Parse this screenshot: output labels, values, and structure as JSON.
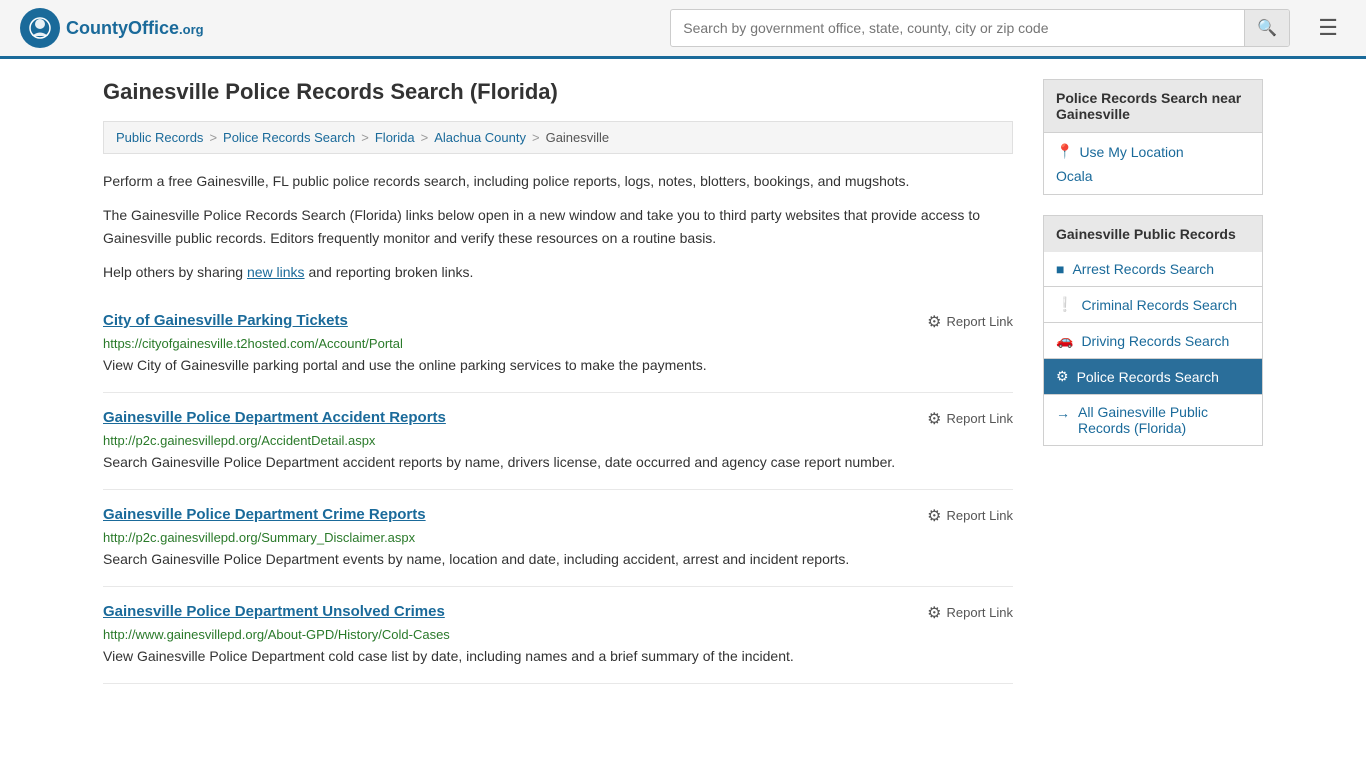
{
  "header": {
    "logo_text": "CountyOffice",
    "logo_org": ".org",
    "search_placeholder": "Search by government office, state, county, city or zip code",
    "search_value": ""
  },
  "page": {
    "title": "Gainesville Police Records Search (Florida)"
  },
  "breadcrumb": {
    "items": [
      {
        "label": "Public Records",
        "url": "#"
      },
      {
        "label": "Police Records Search",
        "url": "#"
      },
      {
        "label": "Florida",
        "url": "#"
      },
      {
        "label": "Alachua County",
        "url": "#"
      },
      {
        "label": "Gainesville",
        "url": "#"
      }
    ]
  },
  "description": {
    "para1": "Perform a free Gainesville, FL public police records search, including police reports, logs, notes, blotters, bookings, and mugshots.",
    "para2": "The Gainesville Police Records Search (Florida) links below open in a new window and take you to third party websites that provide access to Gainesville public records. Editors frequently monitor and verify these resources on a routine basis.",
    "para3_prefix": "Help others by sharing ",
    "para3_link": "new links",
    "para3_suffix": " and reporting broken links."
  },
  "results": [
    {
      "title": "City of Gainesville Parking Tickets",
      "url": "https://cityofgainesville.t2hosted.com/Account/Portal",
      "description": "View City of Gainesville parking portal and use the online parking services to make the payments.",
      "report_label": "Report Link"
    },
    {
      "title": "Gainesville Police Department Accident Reports",
      "url": "http://p2c.gainesvillepd.org/AccidentDetail.aspx",
      "description": "Search Gainesville Police Department accident reports by name, drivers license, date occurred and agency case report number.",
      "report_label": "Report Link"
    },
    {
      "title": "Gainesville Police Department Crime Reports",
      "url": "http://p2c.gainesvillepd.org/Summary_Disclaimer.aspx",
      "description": "Search Gainesville Police Department events by name, location and date, including accident, arrest and incident reports.",
      "report_label": "Report Link"
    },
    {
      "title": "Gainesville Police Department Unsolved Crimes",
      "url": "http://www.gainesvillepd.org/About-GPD/History/Cold-Cases",
      "description": "View Gainesville Police Department cold case list by date, including names and a brief summary of the incident.",
      "report_label": "Report Link"
    }
  ],
  "sidebar": {
    "nearby_title": "Police Records Search near Gainesville",
    "use_my_location": "Use My Location",
    "nearby_links": [
      "Ocala"
    ],
    "public_records_title": "Gainesville Public Records",
    "menu_items": [
      {
        "label": "Arrest Records Search",
        "icon": "■",
        "active": false
      },
      {
        "label": "Criminal Records Search",
        "icon": "!",
        "active": false
      },
      {
        "label": "Driving Records Search",
        "icon": "🚗",
        "active": false
      },
      {
        "label": "Police Records Search",
        "icon": "⚙",
        "active": true
      }
    ],
    "all_records_label": "All Gainesville Public Records (Florida)"
  }
}
